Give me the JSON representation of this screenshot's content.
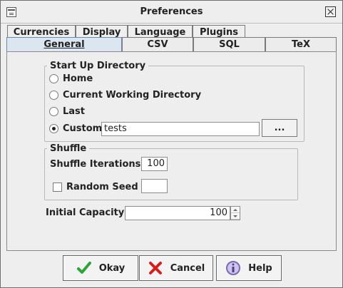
{
  "window": {
    "title": "Preferences"
  },
  "tabs": {
    "top": [
      {
        "label": "Currencies"
      },
      {
        "label": "Display"
      },
      {
        "label": "Language"
      },
      {
        "label": "Plugins"
      }
    ],
    "bottom": [
      {
        "label": "General"
      },
      {
        "label": "CSV"
      },
      {
        "label": "SQL"
      },
      {
        "label": "TeX"
      }
    ]
  },
  "startup": {
    "legend": "Start Up Directory",
    "options": [
      "Home",
      "Current Working Directory",
      "Last",
      "Custom"
    ],
    "selected": "Custom",
    "custom_value": "tests",
    "browse_label": "..."
  },
  "shuffle": {
    "legend": "Shuffle",
    "iterations_label": "Shuffle Iterations",
    "iterations_value": "100",
    "random_seed_label": "Random Seed",
    "random_seed_value": ""
  },
  "capacity": {
    "label": "Initial Capacity",
    "value": "100"
  },
  "buttons": {
    "okay": "Okay",
    "cancel": "Cancel",
    "help": "Help"
  },
  "icons": {
    "okay": "check-icon",
    "cancel": "x-icon",
    "help": "info-icon",
    "close": "close-icon"
  },
  "colors": {
    "active_tab": "#dce6f1",
    "okay_icon": "#2da43a",
    "cancel_icon": "#d51d1d",
    "help_icon": "#7b6ab2"
  }
}
